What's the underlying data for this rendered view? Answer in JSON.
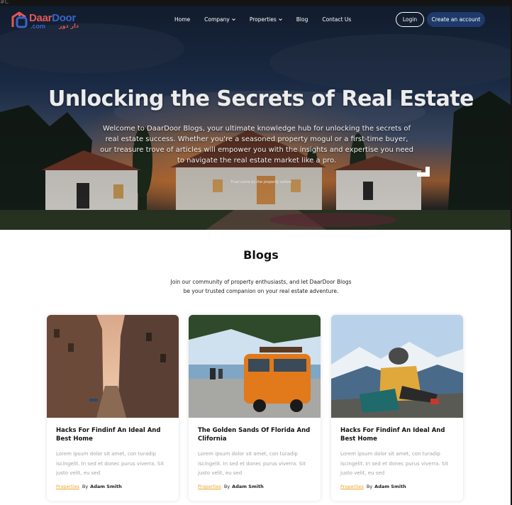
{
  "corner_tag": "#C",
  "brand": {
    "part1": "Daar",
    "part2": "Door",
    "suffix": ".com",
    "arabic": "دار دور"
  },
  "nav": {
    "items": [
      {
        "label": "Home"
      },
      {
        "label": "Company"
      },
      {
        "label": "Properties"
      },
      {
        "label": "Blog"
      },
      {
        "label": "Contact Us"
      }
    ],
    "login_label": "Login",
    "create_account_label": "Create an account"
  },
  "hero": {
    "title": "Unlocking the Secrets of Real Estate",
    "subtitle": "Welcome to DaarDoor Blogs, your ultimate knowledge hub for unlocking the secrets of real estate success. Whether you're a seasoned property mogul or a first-time buyer, our treasure trove of articles will empower you with the insights and expertise you need to navigate the real estate market like a pro.",
    "trust_note": "Trust score by the property sellers"
  },
  "blogs": {
    "title": "Blogs",
    "description_line1": "Join our community of property enthusiasts, and let DaarDoor Blogs",
    "description_line2": "be your trusted companion on your real estate adventure.",
    "cards": [
      {
        "title": "Hacks For Findinf An Ideal And Best Home",
        "excerpt": "Lorem ipsum dolor sit amet, con turadip iscingelit. In sed et donec purus viverra. Sit justo velit, eu sed",
        "category": "Properties",
        "by": "By",
        "author": "Adam Smith"
      },
      {
        "title": "The Golden Sands Of Florida And Clifornia",
        "excerpt": "Lorem ipsum dolor sit amet, con turadip iscingelit. In sed et donec purus viverra. Sit justo velit, eu sed",
        "category": "Properties",
        "by": "By",
        "author": "Adam Smith"
      },
      {
        "title": "Hacks For Findinf An Ideal And Best Home",
        "excerpt": "Lorem ipsum dolor sit amet, con turadip iscingelit. In sed et donec purus viverra. Sit justo velit, eu sed",
        "category": "Properties",
        "by": "By",
        "author": "Adam Smith"
      }
    ]
  },
  "colors": {
    "accent_orange": "#f0a42b",
    "navy_button": "#1e3a6a",
    "logo_red": "#e0585a",
    "logo_blue": "#3b64c8"
  }
}
